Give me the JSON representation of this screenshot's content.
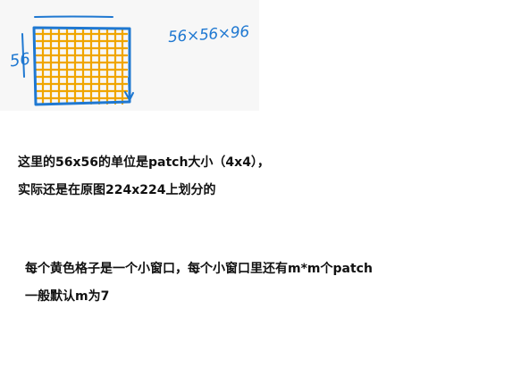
{
  "sketch": {
    "left_label": "56",
    "right_label": "56×56×96",
    "grid_color": "#f0a500",
    "border_color": "#1f78d1"
  },
  "notes": [
    "这里的56x56的单位是patch大小（4x4），",
    "实际还是在原图224x224上划分的",
    "每个黄色格子是一个小窗口，每个小窗口里还有m*m个patch",
    "一般默认m为7"
  ]
}
